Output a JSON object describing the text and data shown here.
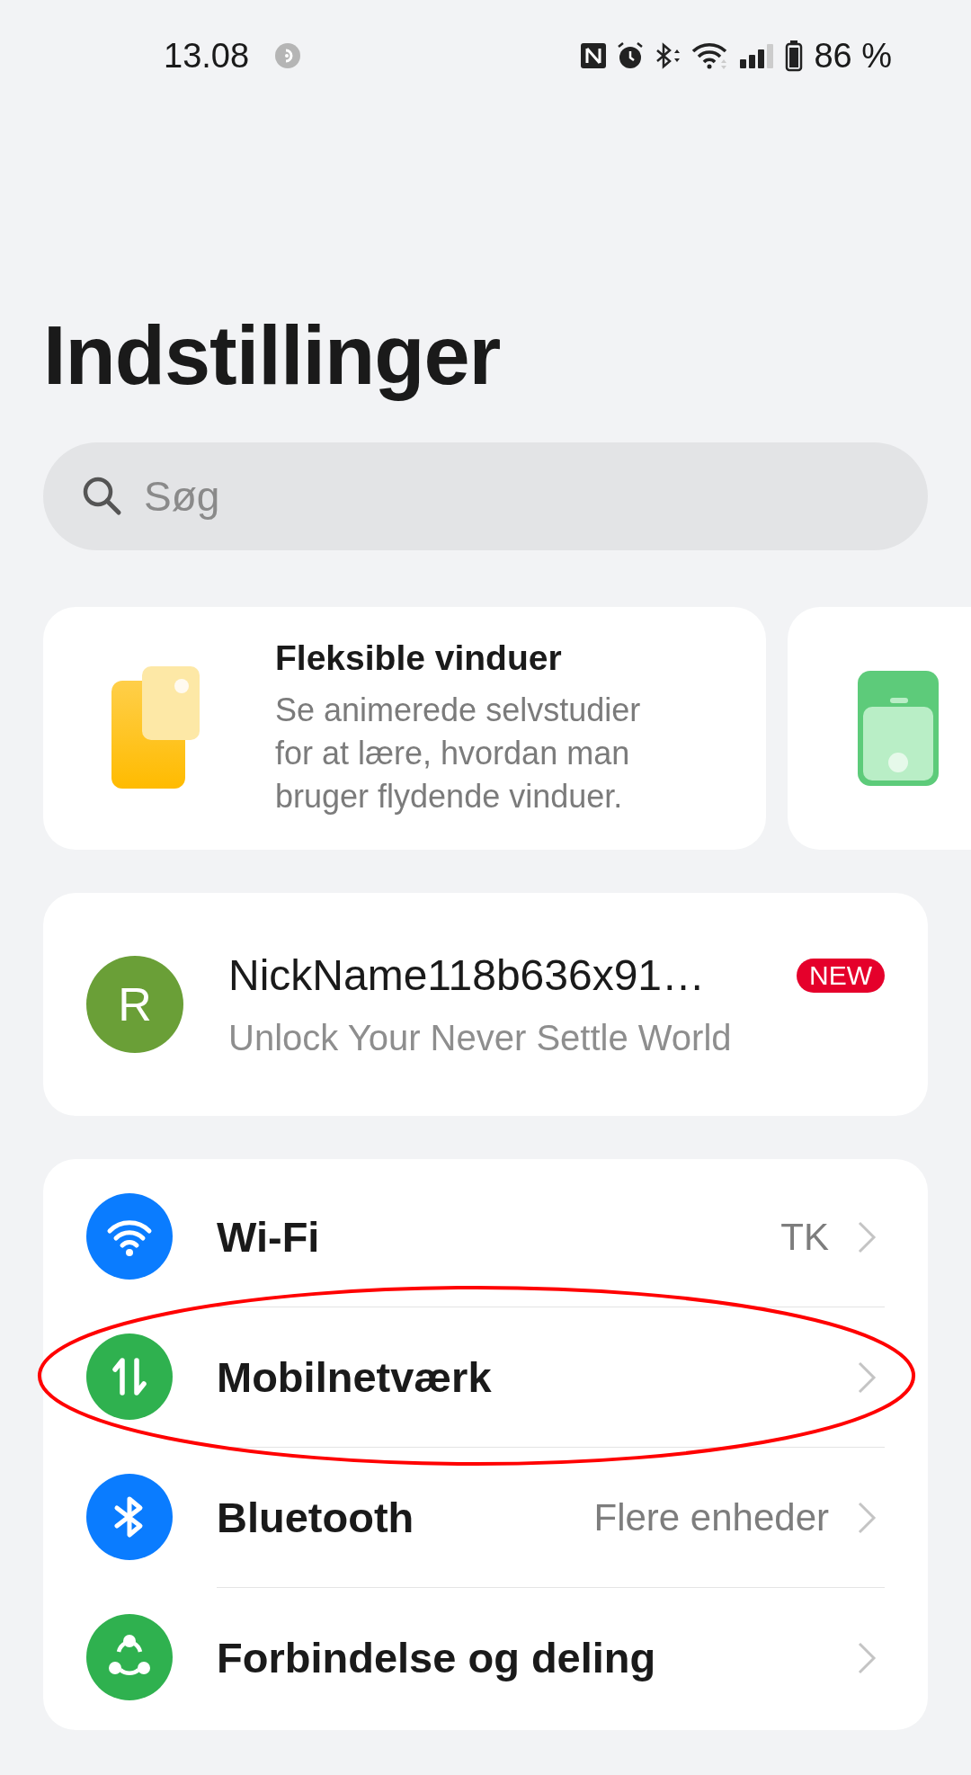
{
  "status_bar": {
    "time": "13.08",
    "battery": "86 %"
  },
  "title": "Indstillinger",
  "search": {
    "placeholder": "Søg"
  },
  "tip_cards": [
    {
      "title": "Fleksible vinduer",
      "description": "Se animerede selvstudier for at lære, hvordan man bruger flydende vinduer."
    },
    {
      "kind": "partial"
    }
  ],
  "profile": {
    "initial": "R",
    "name": "NickName118b636x91…",
    "badge": "NEW",
    "subtitle": "Unlock Your Never Settle World"
  },
  "settings": [
    {
      "label": "Wi-Fi",
      "value": "TK",
      "color": "#0a7cff",
      "circled": false
    },
    {
      "label": "Mobilnetværk",
      "color": "#2fb14f",
      "circled": true
    },
    {
      "label": "Bluetooth",
      "value": "Flere enheder",
      "color": "#0a7cff",
      "circled": false
    },
    {
      "label": "Forbindelse og deling",
      "color": "#2fb14f",
      "circled": false
    }
  ]
}
